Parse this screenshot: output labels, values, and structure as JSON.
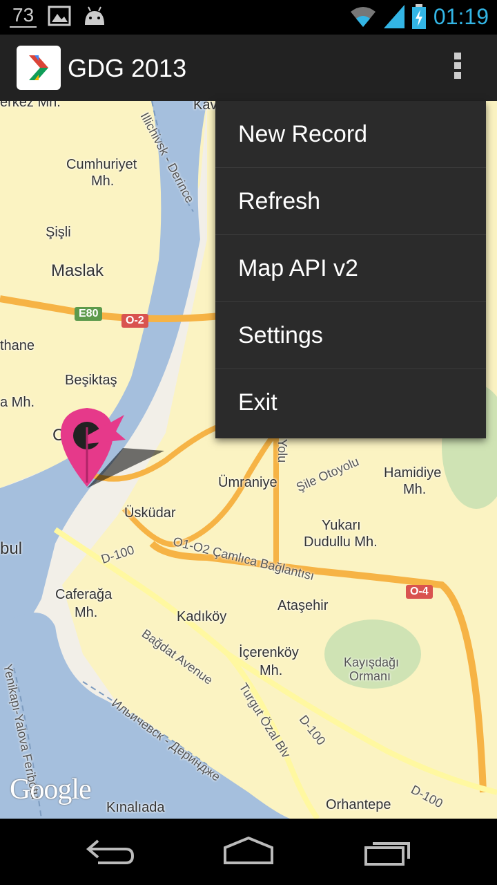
{
  "status_bar": {
    "notification_count": "73",
    "time": "01:19",
    "icons": [
      "image-icon",
      "android-icon",
      "wifi-icon",
      "signal-icon",
      "battery-charging-icon"
    ]
  },
  "action_bar": {
    "title": "GDG 2013",
    "overflow_icon": "overflow-menu-icon"
  },
  "menu": {
    "items": [
      {
        "label": "New Record"
      },
      {
        "label": "Refresh"
      },
      {
        "label": "Map API v2"
      },
      {
        "label": "Settings"
      },
      {
        "label": "Exit"
      }
    ]
  },
  "map": {
    "labels": {
      "merkez": "erkez Mh.",
      "kav": "Kav",
      "cumhuriyet": "Cumhuriyet",
      "cumhuriyet_mh": "Mh.",
      "sisli": "Şişli",
      "maslak": "Maslak",
      "thane": "thane",
      "besiktas": "Beşiktaş",
      "mh_left": "a Mh.",
      "c_left": "C",
      "bul": "bul",
      "umraniye": "Ümraniye",
      "uskudar": "Üsküdar",
      "hamidiye": "Hamidiye",
      "hamidiye_mh": "Mh.",
      "yukari": "Yukarı",
      "dudullu": "Dudullu Mh.",
      "caferaga": "Caferağa",
      "caferaga_mh": "Mh.",
      "kadikoy": "Kadıköy",
      "atasehir": "Ataşehir",
      "icerenkoy": "İçerenköy",
      "icerenkoy_mh": "Mh.",
      "kayisdagi": "Kayışdağı",
      "ormani": "Ormanı",
      "kinaliada": "Kınalıada",
      "orhantepe": "Orhantepe",
      "highway_illichivsk": "Illichivsk - Derince",
      "highway_ilichevsk_ru": "Ильичевск - Дериндже",
      "yenikapi": "Yenikapı-Yalova Feribotu",
      "sile": "Şile Otoyolu",
      "camlica": "O1-O2 Çamlıca Bağlantısı",
      "bagdat": "Bağdat Avenue",
      "turgut": "Turgut Özal Blv",
      "d100_a": "D-100",
      "d100_b": "D-100",
      "d100_c": "D-100",
      "yolu": "Yolu"
    },
    "shields": {
      "e80": "E80",
      "o2": "O-2",
      "o4": "O-4"
    },
    "attribution": "Google",
    "marker_icon": "map-pin-marker-icon"
  },
  "nav_bar": {
    "back_icon": "back-icon",
    "home_icon": "home-icon",
    "recents_icon": "recent-apps-icon"
  },
  "colors": {
    "accent": "#33b5e5",
    "water": "#a5bfdd",
    "land": "#f2efe8",
    "road_yellow": "#fff8a0",
    "highway_orange": "#f6b345",
    "marker": "#e6398a"
  }
}
